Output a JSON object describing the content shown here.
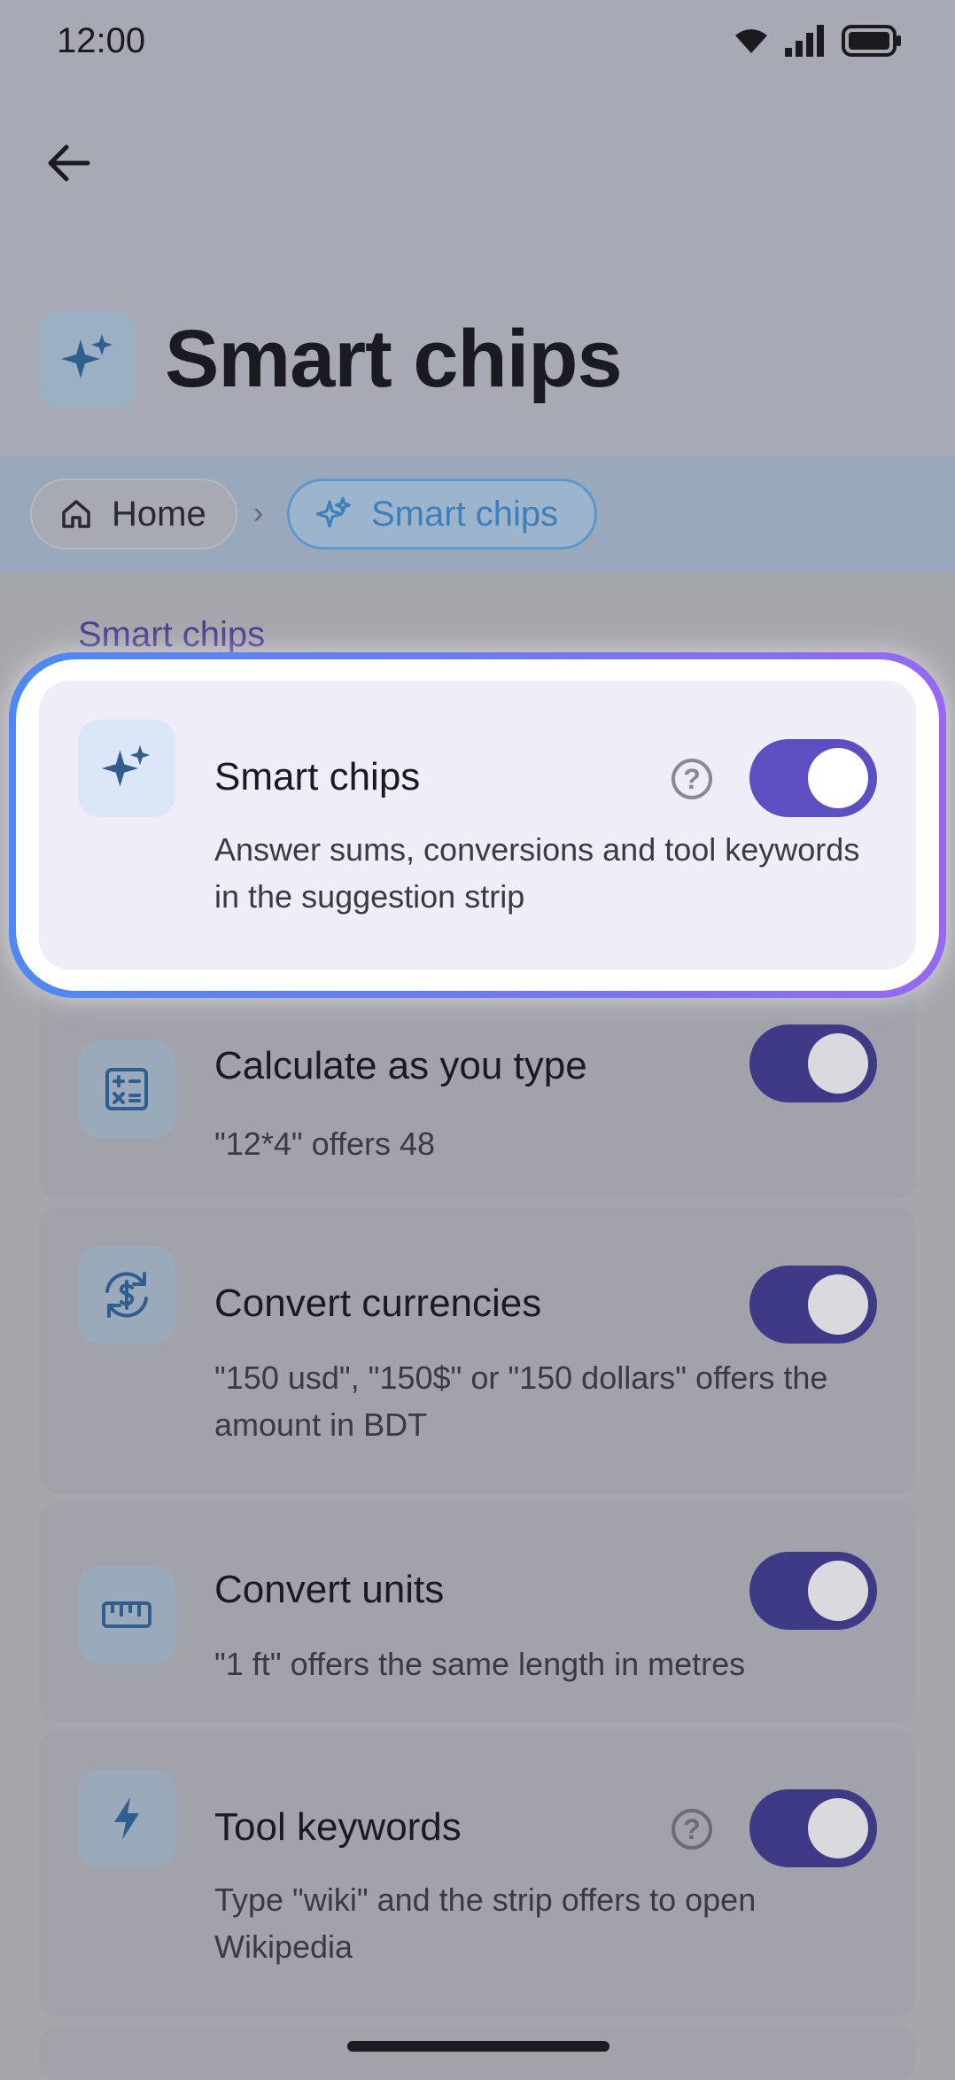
{
  "status_bar": {
    "time": "12:00"
  },
  "header": {
    "title": "Smart chips"
  },
  "breadcrumb": {
    "home": "Home",
    "separator": "›",
    "current": "Smart chips"
  },
  "section": {
    "label": "Smart chips"
  },
  "settings": [
    {
      "title": "Smart chips",
      "description": "Answer sums, conversions and tool keywords in the suggestion strip",
      "enabled": true,
      "has_help": true,
      "icon": "sparkle-icon",
      "highlighted": true
    },
    {
      "title": "Calculate as you type",
      "description": "\"12*4\" offers 48",
      "enabled": true,
      "has_help": false,
      "icon": "calculator-icon"
    },
    {
      "title": "Convert currencies",
      "description": "\"150 usd\", \"150$\" or \"150 dollars\" offers the amount in BDT",
      "enabled": true,
      "has_help": false,
      "icon": "currency-exchange-icon"
    },
    {
      "title": "Convert units",
      "description": "\"1 ft\" offers the same length in metres",
      "enabled": true,
      "has_help": false,
      "icon": "ruler-icon"
    },
    {
      "title": "Tool keywords",
      "description": "Type \"wiki\" and the strip offers to open Wikipedia",
      "enabled": true,
      "has_help": true,
      "icon": "bolt-icon"
    }
  ],
  "help_glyph": "?",
  "colors": {
    "accent": "#5b4fc2",
    "highlight_glow_start": "#4f88f2",
    "highlight_glow_end": "#9868f2",
    "crumb_active": "#3c7fbd"
  }
}
